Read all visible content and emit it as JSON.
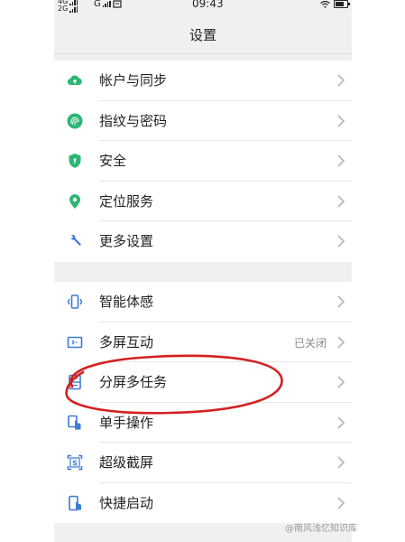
{
  "status_bar": {
    "net_4g": "4G",
    "net_2g": "2G",
    "net_g": "G",
    "time": "09:43"
  },
  "header": {
    "title": "设置"
  },
  "groups": [
    {
      "items": [
        {
          "label": "帐户与同步",
          "icon": "cloud-icon",
          "color": "#2bb673"
        },
        {
          "label": "指纹与密码",
          "icon": "fingerprint-icon",
          "color": "#2bb673"
        },
        {
          "label": "安全",
          "icon": "shield-icon",
          "color": "#2bb673"
        },
        {
          "label": "定位服务",
          "icon": "location-pin-icon",
          "color": "#2bb673"
        },
        {
          "label": "更多设置",
          "icon": "wrench-icon",
          "color": "#3d7ad6"
        }
      ]
    },
    {
      "items": [
        {
          "label": "智能体感",
          "icon": "smart-motion-icon",
          "color": "#3d7ad6"
        },
        {
          "label": "多屏互动",
          "icon": "multi-screen-icon",
          "color": "#3d7ad6",
          "value": "已关闭"
        },
        {
          "label": "分屏多任务",
          "icon": "split-screen-icon",
          "color": "#3d7ad6"
        },
        {
          "label": "单手操作",
          "icon": "one-hand-icon",
          "color": "#3d7ad6"
        },
        {
          "label": "超级截屏",
          "icon": "screenshot-icon",
          "color": "#3d7ad6"
        },
        {
          "label": "快捷启动",
          "icon": "quick-launch-icon",
          "color": "#3d7ad6"
        }
      ]
    }
  ],
  "annotation": {
    "color": "#d42020"
  },
  "watermark": "@南风浅忆知识库"
}
